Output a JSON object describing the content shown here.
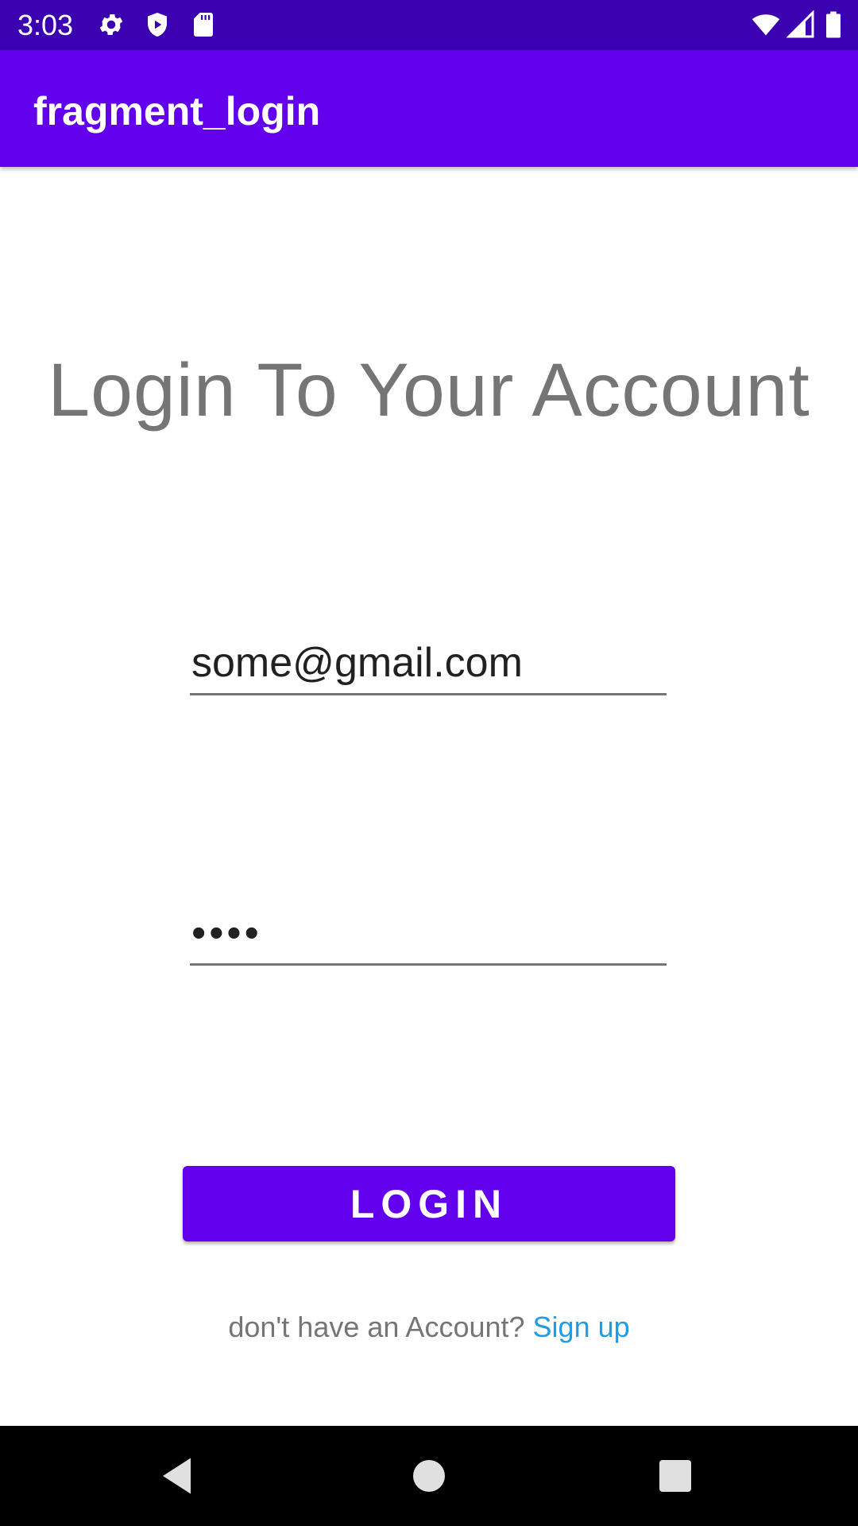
{
  "status_bar": {
    "time": "3:03",
    "left_icons": [
      "gear-icon",
      "shield-play-icon",
      "sd-card-icon"
    ],
    "right_icons": [
      "wifi-icon",
      "signal-icon",
      "battery-icon"
    ],
    "color": "#3b00b0"
  },
  "app_bar": {
    "title": "fragment_login",
    "color": "#6200ee"
  },
  "login": {
    "heading": "Login To Your Account",
    "email_value": "some@gmail.com",
    "password_value": "••••",
    "button_label": "LOGIN",
    "signup_prompt": "don't have an Account? ",
    "signup_link": "Sign up",
    "accent_color": "#6200ee",
    "link_color": "#1e9be9"
  },
  "nav_bar": {
    "buttons": [
      "back-icon",
      "home-icon",
      "recents-icon"
    ]
  }
}
